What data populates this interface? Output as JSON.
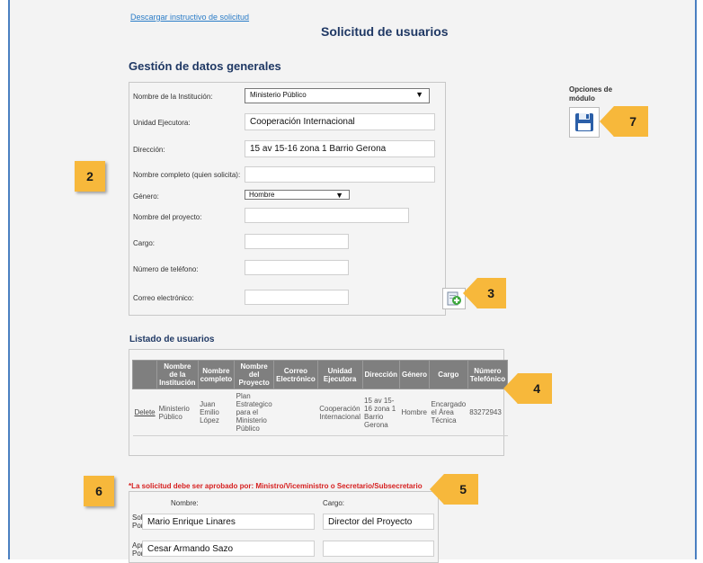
{
  "header": {
    "download_link": "Descargar instructivo de solicitud",
    "title": "Solicitud de usuarios"
  },
  "general": {
    "section_title": "Gestión de datos generales",
    "fields": {
      "institucion": {
        "label": "Nombre de la Institución:",
        "value": "Ministerio Público"
      },
      "unidad": {
        "label": "Unidad Ejecutora:",
        "value": "Cooperación Internacional"
      },
      "direccion": {
        "label": "Dirección:",
        "value": "15 av 15-16 zona 1 Barrio Gerona"
      },
      "nombre": {
        "label": "Nombre completo (quien solicita):",
        "value": ""
      },
      "genero": {
        "label": "Género:",
        "value": "Hombre"
      },
      "proyecto": {
        "label": "Nombre del proyecto:",
        "value": ""
      },
      "cargo": {
        "label": "Cargo:",
        "value": ""
      },
      "telefono": {
        "label": "Número de teléfono:",
        "value": ""
      },
      "correo": {
        "label": "Correo electrónico:",
        "value": ""
      }
    }
  },
  "options": {
    "label": "Opciones de módulo",
    "save_icon": "floppy-disk-icon"
  },
  "list": {
    "title": "Listado de usuarios",
    "columns": [
      "",
      "Nombre de la Institución",
      "Nombre completo",
      "Nombre del Proyecto",
      "Correo Electrónico",
      "Unidad Ejecutora",
      "Dirección",
      "Género",
      "Cargo",
      "Número Telefónico"
    ],
    "rows": [
      {
        "action": "Delete",
        "institucion": "Ministerio Público",
        "nombre": "Juan Emilio López",
        "proyecto": "Plan Estrategico para el Ministerio Público",
        "correo": "",
        "unidad": "Cooperación Internacional",
        "direccion": "15 av 15-16 zona 1 Barrio Gerona",
        "genero": "Hombre",
        "cargo": "Encargado el Área Técnica",
        "telefono": "83272943"
      }
    ]
  },
  "approval": {
    "warning": "*La solicitud debe ser aprobado por: Ministro/Viceministro o Secretario/Subsecretario",
    "col_nombre": "Nombre:",
    "col_cargo": "Cargo:",
    "solicitado_label": "Solicitado Por:",
    "solicitado_nombre": "Mario Enrique Linares",
    "solicitado_cargo": "Director del Proyecto",
    "aprobado_label": "Aprobado Por:",
    "aprobado_nombre": "Cesar Armando Sazo",
    "aprobado_cargo": ""
  },
  "callouts": {
    "c2": "2",
    "c3": "3",
    "c4": "4",
    "c5": "5",
    "c6": "6",
    "c7": "7"
  },
  "colors": {
    "callout": "#f7b83b",
    "title": "#1f3864",
    "warning": "#d61f1f",
    "frame": "#4a7fc1"
  }
}
